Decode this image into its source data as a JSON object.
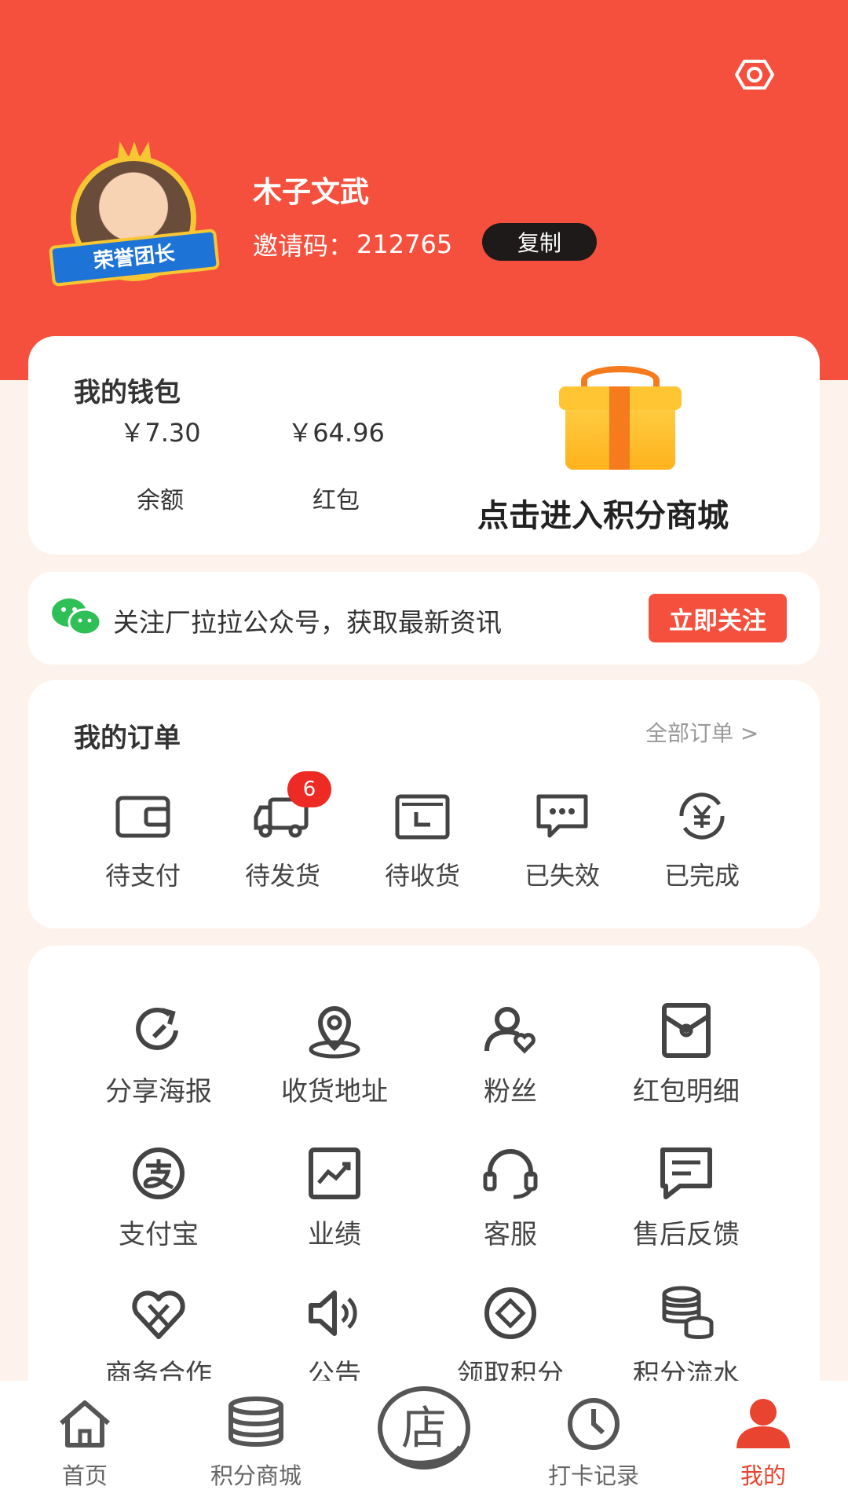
{
  "colors": {
    "brand": "#f5503d",
    "page_bg": "#fdf3ec",
    "text": "#333333",
    "muted": "#999999",
    "badge": "#ee2a24"
  },
  "header": {
    "settings_icon": "settings-icon",
    "avatar_badge_text": "荣誉团长",
    "username": "木子文武",
    "invite_label": "邀请码：",
    "invite_code": "212765",
    "copy_label": "复制"
  },
  "wallet": {
    "title": "我的钱包",
    "items": [
      {
        "amount": "￥7.30",
        "label": "余额"
      },
      {
        "amount": "￥64.96",
        "label": "红包"
      }
    ],
    "mall_entry": "点击进入积分商城"
  },
  "follow": {
    "text": "关注厂拉拉公众号，获取最新资讯",
    "button": "立即关注"
  },
  "orders": {
    "title": "我的订单",
    "all_link": "全部订单 >",
    "badge_count": "6",
    "items": [
      {
        "label": "待支付",
        "icon": "wallet-icon"
      },
      {
        "label": "待发货",
        "icon": "truck-icon"
      },
      {
        "label": "待收货",
        "icon": "box-icon"
      },
      {
        "label": "已失效",
        "icon": "chat-bubble-icon"
      },
      {
        "label": "已完成",
        "icon": "yen-refresh-icon"
      }
    ]
  },
  "tools": [
    {
      "label": "分享海报",
      "icon": "share-refresh-icon"
    },
    {
      "label": "收货地址",
      "icon": "location-pin-icon"
    },
    {
      "label": "粉丝",
      "icon": "fans-heart-icon"
    },
    {
      "label": "红包明细",
      "icon": "red-packet-icon"
    },
    {
      "label": "支付宝",
      "icon": "alipay-icon"
    },
    {
      "label": "业绩",
      "icon": "chart-icon"
    },
    {
      "label": "客服",
      "icon": "headset-icon"
    },
    {
      "label": "售后反馈",
      "icon": "message-icon"
    },
    {
      "label": "商务合作",
      "icon": "handshake-icon"
    },
    {
      "label": "公告",
      "icon": "speaker-icon"
    },
    {
      "label": "领取积分",
      "icon": "diamond-icon"
    },
    {
      "label": "积分流水",
      "icon": "coin-stack-icon"
    }
  ],
  "tabbar": {
    "items": [
      {
        "label": "首页",
        "icon": "home-icon"
      },
      {
        "label": "积分商城",
        "icon": "coins-icon"
      },
      {
        "label": "打卡记录",
        "icon": "clock-icon"
      },
      {
        "label": "我的",
        "icon": "user-icon"
      }
    ],
    "center_label": "店",
    "active": "我的"
  }
}
